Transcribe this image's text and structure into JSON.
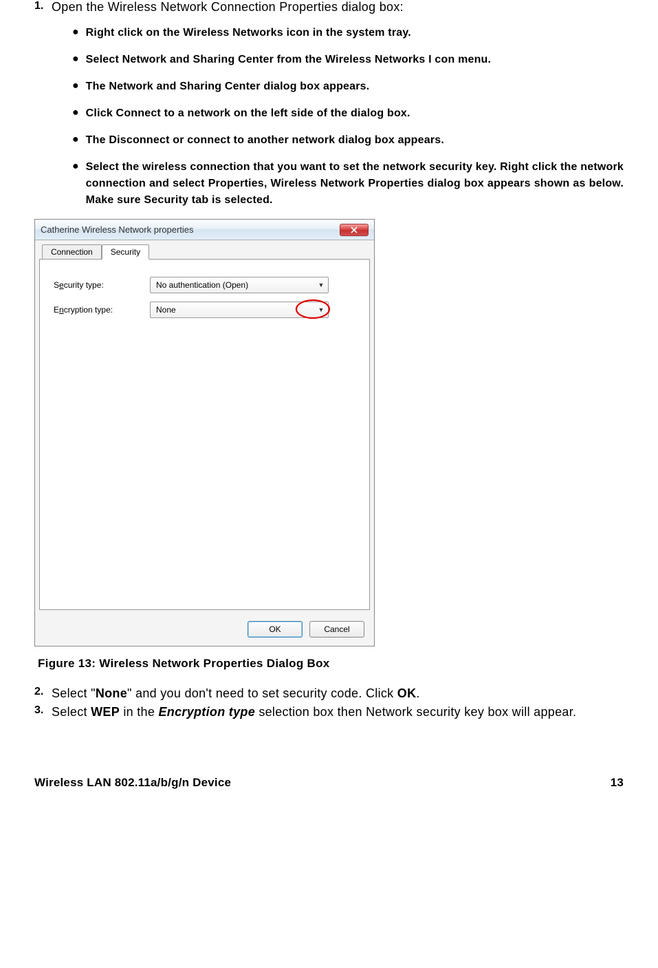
{
  "step1": {
    "num": "1.",
    "text": "Open the Wireless Network Connection Properties dialog box:"
  },
  "bullets": [
    "Right click on the Wireless Networks icon in the system tray.",
    "Select Network and Sharing Center from the Wireless Networks I con menu.",
    "The Network and Sharing Center dialog box appears.",
    "Click Connect to a network on the left side of the dialog box.",
    "The Disconnect or connect to another network dialog box appears.",
    "Select the wireless connection that you want to set the network security key. Right click the network connection and select Properties, Wireless Network Properties dialog box appears shown as below.  Make sure Security tab is selected."
  ],
  "dialog": {
    "title": "Catherine Wireless Network properties",
    "tabs": {
      "connection": "Connection",
      "security": "Security"
    },
    "securityTypeLabel": "Security type:",
    "securityTypeLabelPrefix": "S",
    "securityTypeLabelUnder": "e",
    "securityTypeLabelRest": "curity type:",
    "encryptionLabelPrefix": "E",
    "encryptionLabelUnder": "n",
    "encryptionLabelRest": "cryption type:",
    "securityTypeValue": "No authentication (Open)",
    "encryptionTypeValue": "None",
    "okButton": "OK",
    "cancelButton": "Cancel",
    "closeX": "X"
  },
  "figureCaption": "Figure 13: Wireless Network Properties Dialog Box",
  "step2": {
    "num": "2.",
    "prefix": "Select \"",
    "bold1": "None",
    "mid": "\" and you don't need to set security code. Click ",
    "bold2": "OK",
    "suffix": "."
  },
  "step3": {
    "num": "3.",
    "prefix": "Select ",
    "bold1": "WEP",
    "mid1": " in the ",
    "italic1": "Encryption type",
    "suffix": " selection box then Network security key box will appear."
  },
  "footer": {
    "left": "Wireless LAN 802.11a/b/g/n Device",
    "right": "13"
  }
}
